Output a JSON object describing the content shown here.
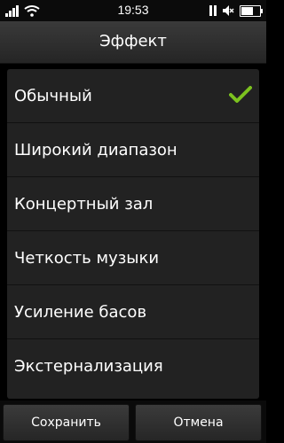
{
  "status_bar": {
    "time": "19:53",
    "icons": [
      "signal-icon",
      "wifi-icon",
      "pause-icon",
      "mute-icon",
      "battery-icon"
    ],
    "battery_level": 0.7
  },
  "header": {
    "title": "Эффект"
  },
  "effects": [
    {
      "label": "Обычный",
      "selected": true
    },
    {
      "label": "Широкий диапазон",
      "selected": false
    },
    {
      "label": "Концертный зал",
      "selected": false
    },
    {
      "label": "Четкость музыки",
      "selected": false
    },
    {
      "label": "Усиление басов",
      "selected": false
    },
    {
      "label": "Экстернализация",
      "selected": false
    }
  ],
  "footer": {
    "save_label": "Сохранить",
    "cancel_label": "Отмена"
  },
  "colors": {
    "check": "#7cc21f",
    "list_bg": "#222222",
    "background": "#000000"
  }
}
